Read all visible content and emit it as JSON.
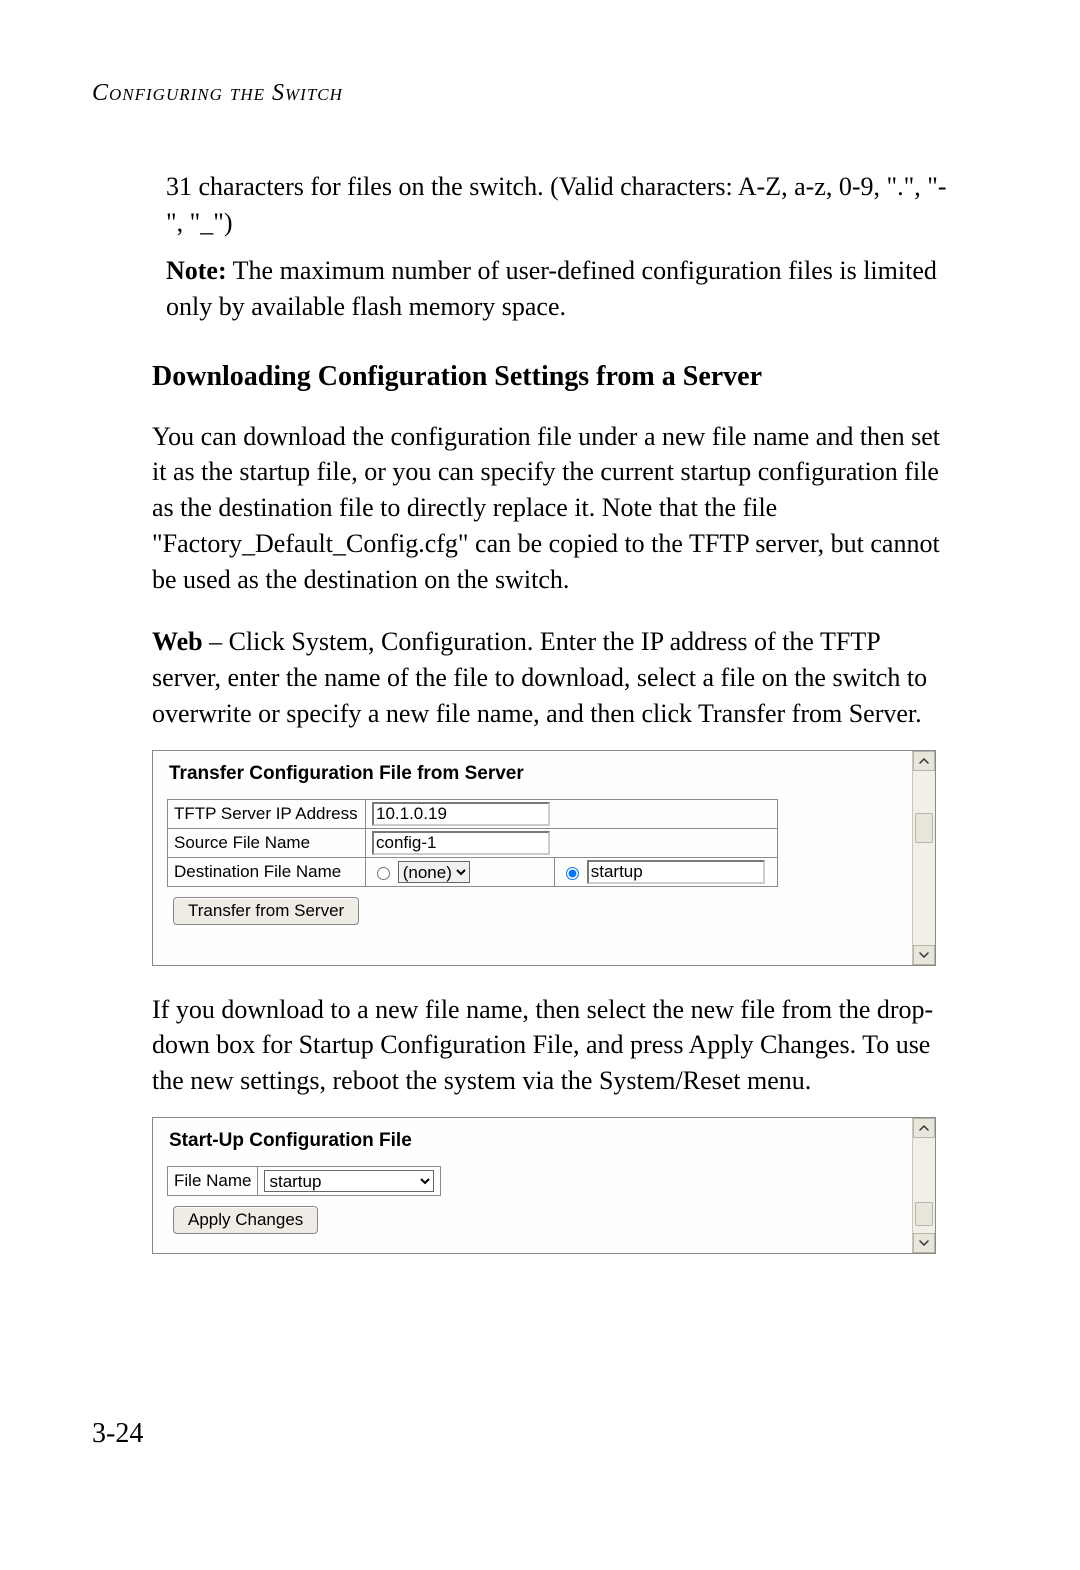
{
  "header": {
    "running": "Configuring the Switch"
  },
  "intro": {
    "line1": "31 characters for files on the switch. (Valid characters: A-Z, a-z, 0-9, \".\", \"-\", \"_\")",
    "note_label": "Note:",
    "note_text": "The maximum number of user-defined configuration files is limited only by available flash memory space."
  },
  "section": {
    "heading": "Downloading Configuration Settings from a Server",
    "p1": "You can download the configuration file under a new file name and then set it as the startup file, or you can specify the current startup configuration file as the destination file to directly replace it. Note that the file \"Factory_Default_Config.cfg\" can be copied to the TFTP server, but cannot be used as the destination on the switch.",
    "web_label": "Web",
    "p2_rest": " – Click System, Configuration. Enter the IP address of the TFTP server, enter the name of the file to download, select a file on the switch to overwrite or specify a new file name, and then click Transfer from Server.",
    "p3": "If you download to a new file name, then select the new file from the drop-down box for Startup Configuration File, and press Apply Changes. To use the new settings, reboot the system via the System/Reset menu."
  },
  "transfer_panel": {
    "title": "Transfer Configuration File from Server",
    "rows": {
      "ip_label": "TFTP Server IP Address",
      "ip_value": "10.1.0.19",
      "src_label": "Source File Name",
      "src_value": "config-1",
      "dst_label": "Destination File Name",
      "dst_select_value": "(none)",
      "dst_text_value": "startup"
    },
    "button": "Transfer from Server"
  },
  "startup_panel": {
    "title": "Start-Up Configuration File",
    "file_label": "File Name",
    "file_value": "startup",
    "button": "Apply Changes"
  },
  "page_number": "3-24"
}
